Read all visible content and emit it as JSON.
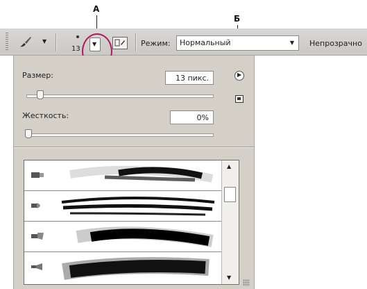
{
  "callouts": {
    "a": "A",
    "b": "Б"
  },
  "toolbar": {
    "brush_tool_icon": "brush-icon",
    "brush_size": "13",
    "mode_label": "Режим:",
    "mode_value": "Нормальный",
    "opacity_label": "Непрозрачно"
  },
  "panel": {
    "size_label": "Размер:",
    "size_value": "13 пикс.",
    "size_slider_level": 0.08,
    "hardness_label": "Жесткость:",
    "hardness_value": "0%",
    "hardness_slider_level": 0.0,
    "menu_icon": "menu-arrow-icon",
    "new_preset_icon": "new-preset-icon",
    "presets": [
      {
        "icon": "flat-brush-icon"
      },
      {
        "icon": "round-brush-icon"
      },
      {
        "icon": "fan-brush-icon"
      },
      {
        "icon": "angled-brush-icon"
      }
    ]
  },
  "colors": {
    "highlight": "#b3195a",
    "panel_bg": "#d4d0c8",
    "toolbar_bg": "#d2d0cc"
  }
}
